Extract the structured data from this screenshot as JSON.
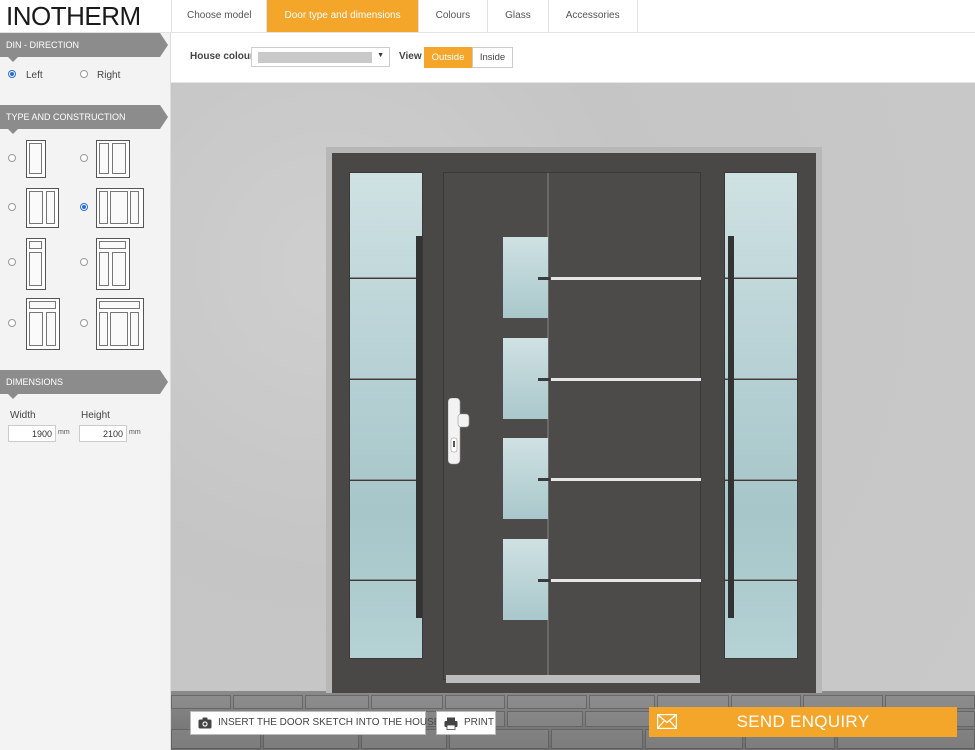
{
  "brand": {
    "logo": "INOTHERM",
    "accent": "#f4a62a"
  },
  "tabs": [
    {
      "label": "Choose model",
      "active": false
    },
    {
      "label": "Door type and dimensions",
      "active": true
    },
    {
      "label": "Colours",
      "active": false
    },
    {
      "label": "Glass",
      "active": false
    },
    {
      "label": "Accessories",
      "active": false
    }
  ],
  "sidebar": {
    "din": {
      "title": "DIN - DIRECTION",
      "options": [
        {
          "label": "Left",
          "selected": true
        },
        {
          "label": "Right",
          "selected": false
        }
      ]
    },
    "type": {
      "title": "TYPE AND CONSTRUCTION",
      "selected_index": 3
    },
    "dimensions": {
      "title": "DIMENSIONS",
      "width_label": "Width",
      "height_label": "Height",
      "width_value": "1900",
      "height_value": "2100",
      "unit": "mm"
    }
  },
  "toolbar": {
    "house_colour_label": "House colour",
    "view_label": "View",
    "view_options": [
      {
        "label": "Outside",
        "active": true
      },
      {
        "label": "Inside",
        "active": false
      }
    ]
  },
  "actions": {
    "insert_label": "INSERT THE DOOR SKETCH INTO THE HOUSE",
    "print_label": "PRINT",
    "send_label": "SEND ENQUIRY"
  },
  "icons": {
    "camera": "camera-icon",
    "print": "printer-icon",
    "send": "envelope-icon",
    "dropdown": "chevron-down-icon"
  }
}
